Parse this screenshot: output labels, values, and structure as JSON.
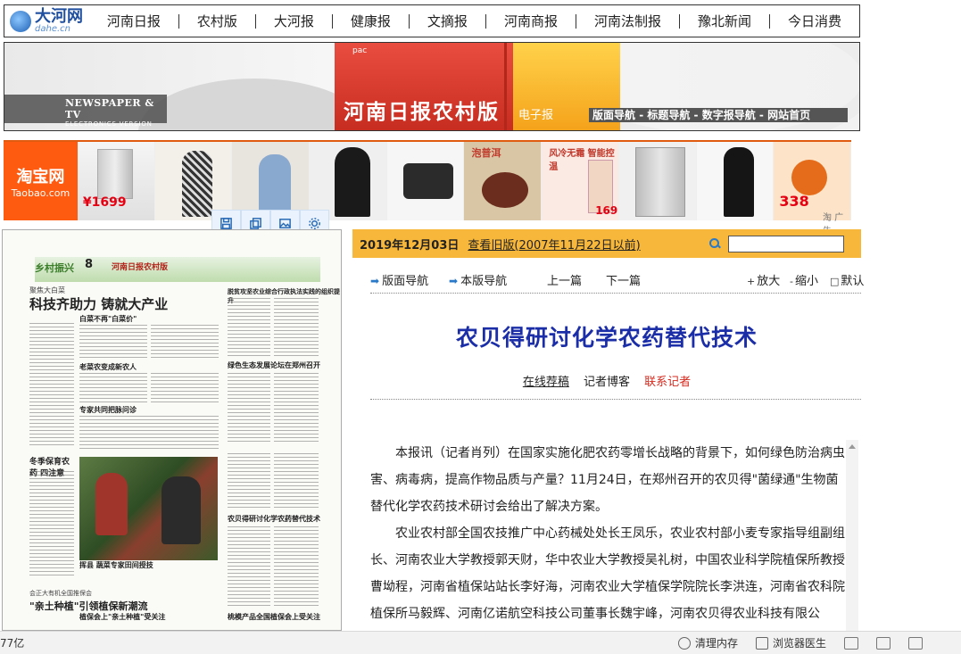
{
  "logo": {
    "cn": "大河网",
    "en": "dahe.cn"
  },
  "topnav": [
    "河南日报",
    "农村版",
    "大河报",
    "健康报",
    "文摘报",
    "河南商报",
    "河南法制报",
    "豫北新闻",
    "今日消费"
  ],
  "banner": {
    "np_title": "NEWSPAPER & TV",
    "np_sub": "ELECTRONICS VERSION",
    "pac": "pac",
    "paper_title": "河南日报农村版",
    "epaper": "电子报",
    "nav": [
      "版面导航",
      "标题导航",
      "数字报导航",
      "网站首页"
    ],
    "nav_sep": " - "
  },
  "ads": {
    "taobao_cn": "淘宝网",
    "taobao_en": "Taobao.com",
    "price1": "¥1699",
    "promo1": "泡普洱",
    "promo2": "风冷无霜 智能控温",
    "price2": "1699",
    "price3": "338",
    "label": "淘 广告"
  },
  "image_tools": [
    "save-icon",
    "copy-icon",
    "image-icon",
    "settings-icon"
  ],
  "paper_preview": {
    "section": "乡村振兴",
    "page_no": "8",
    "paper_name": "河南日报农村版",
    "sub1": "聚焦大白菜",
    "headline": "科技齐助力 铸就大产业",
    "sub2": "白菜不再\"白菜价\"",
    "right_head1": "脱贫攻坚农业综合行政执法实践的组织提升",
    "mid_head1": "老菜农变成新农人",
    "right_head2": "绿色生态发展论坛在郑州召开",
    "mid_head2": "专家共同把脉问诊",
    "left_head": "冬季保育农药 四注意",
    "right_head3": "农贝得研讨化学农药替代技术",
    "photo_caption": "挥县 蔬菜专家田间授技",
    "bottom_sub": "会正大有机全国推保会",
    "bottom_head": "\"亲土种植\"引领植保新潮流",
    "bottom_head2": "植保会上\"亲土种植\"受关注",
    "right_head4": "桃模产品全国植保会上受关注"
  },
  "article": {
    "date": "2019年12月03日",
    "old_edition": "查看旧版(2007年11月22日以前)",
    "search_placeholder": "",
    "nav": {
      "page_nav": "版面导航",
      "this_page_nav": "本版导航",
      "prev": "上一篇",
      "next": "下一篇",
      "zoom_in": "放大",
      "zoom_out": "缩小",
      "default": "默认",
      "zoom_in_mark": "+",
      "zoom_out_mark": "-",
      "default_mark": "□"
    },
    "title": "农贝得研讨化学农药替代技术",
    "byline": {
      "recommend": "在线荐稿",
      "blog": "记者博客",
      "contact": "联系记者"
    },
    "paragraphs": [
      "本报讯（记者肖列）在国家实施化肥农药零增长战略的背景下，如何绿色防治病虫害、病毒病，提高作物品质与产量？11月24日，在郑州召开的农贝得\"菌绿通\"生物菌替代化学农药技术研讨会给出了解决方案。",
      "农业农村部全国农技推广中心药械处处长王凤乐，农业农村部小麦专家指导组副组长、河南农业大学教授郭天财，华中农业大学教授吴礼树，中国农业科学院植保所教授曹坳程，河南省植保站站长李好海，河南农业大学植保学院院长李洪连，河南省农科院植保所马毅辉、河南亿诺航空科技公司董事长魏宇峰，河南农贝得农业科技有限公"
    ]
  },
  "statusbar": {
    "left_text": "77亿",
    "clean_mem": "清理内存",
    "browser_doctor": "浏览器医生"
  }
}
